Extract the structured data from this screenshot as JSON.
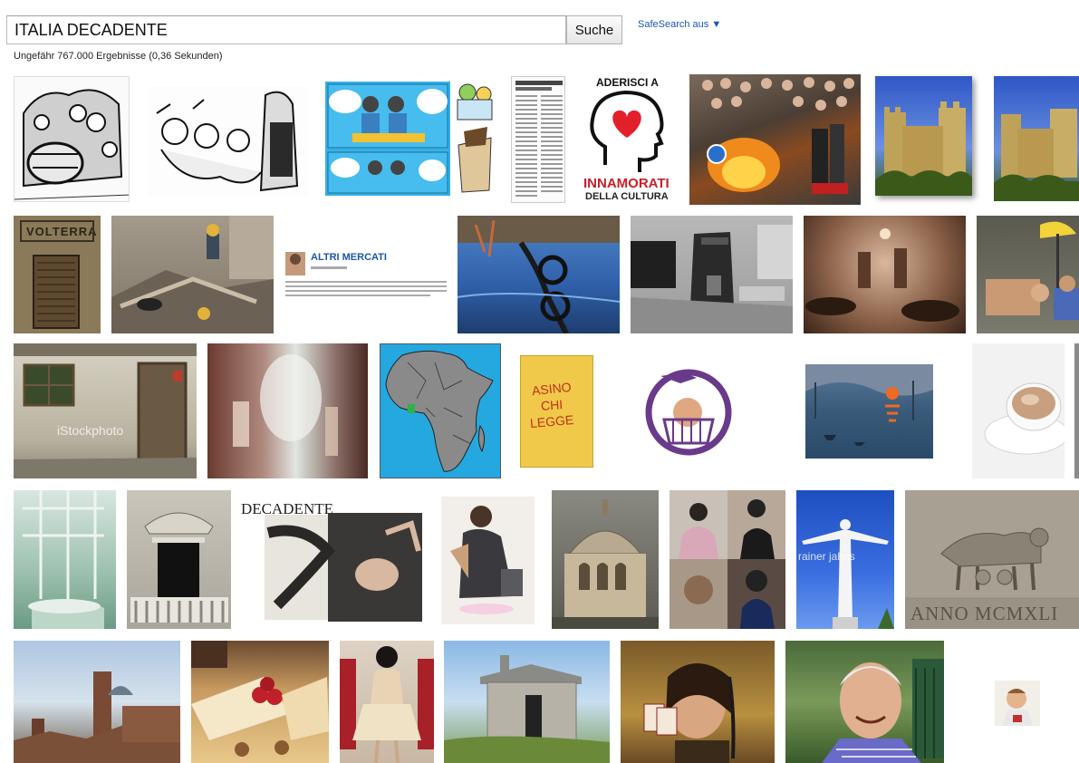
{
  "search": {
    "query": "ITALIA DECADENTE",
    "button_label": "Suche",
    "safesearch_label": "SafeSearch aus ▼"
  },
  "results": {
    "stats": "Ungefähr 767.000 Ergebnisse (0,36 Sekunden)"
  },
  "thumbnails": {
    "volterra_sign": "VOLTERRA",
    "altri_mercati_title": "ALTRI MERCATI",
    "aderisci_top": "ADERISCI A",
    "aderisci_bottom_1": "INNAMORATI",
    "aderisci_bottom_2": "DELLA CULTURA",
    "istock_watermark": "iStockphoto",
    "asimo_text_1": "ASINO",
    "asimo_text_2": "CHI",
    "asimo_text_3": "LEGGE",
    "decadente_heading": "DECADENTE",
    "rainer_watermark": "rainer jahns",
    "anno_inscription": "ANNO MCMXLI"
  },
  "colors": {
    "link_blue": "#1a55b8",
    "heart_red": "#e3202a",
    "cultura_red": "#c8202a",
    "africa_sea": "#25a8e0",
    "book_yellow": "#f0c94a",
    "fist_purple": "#6a3a8a"
  }
}
